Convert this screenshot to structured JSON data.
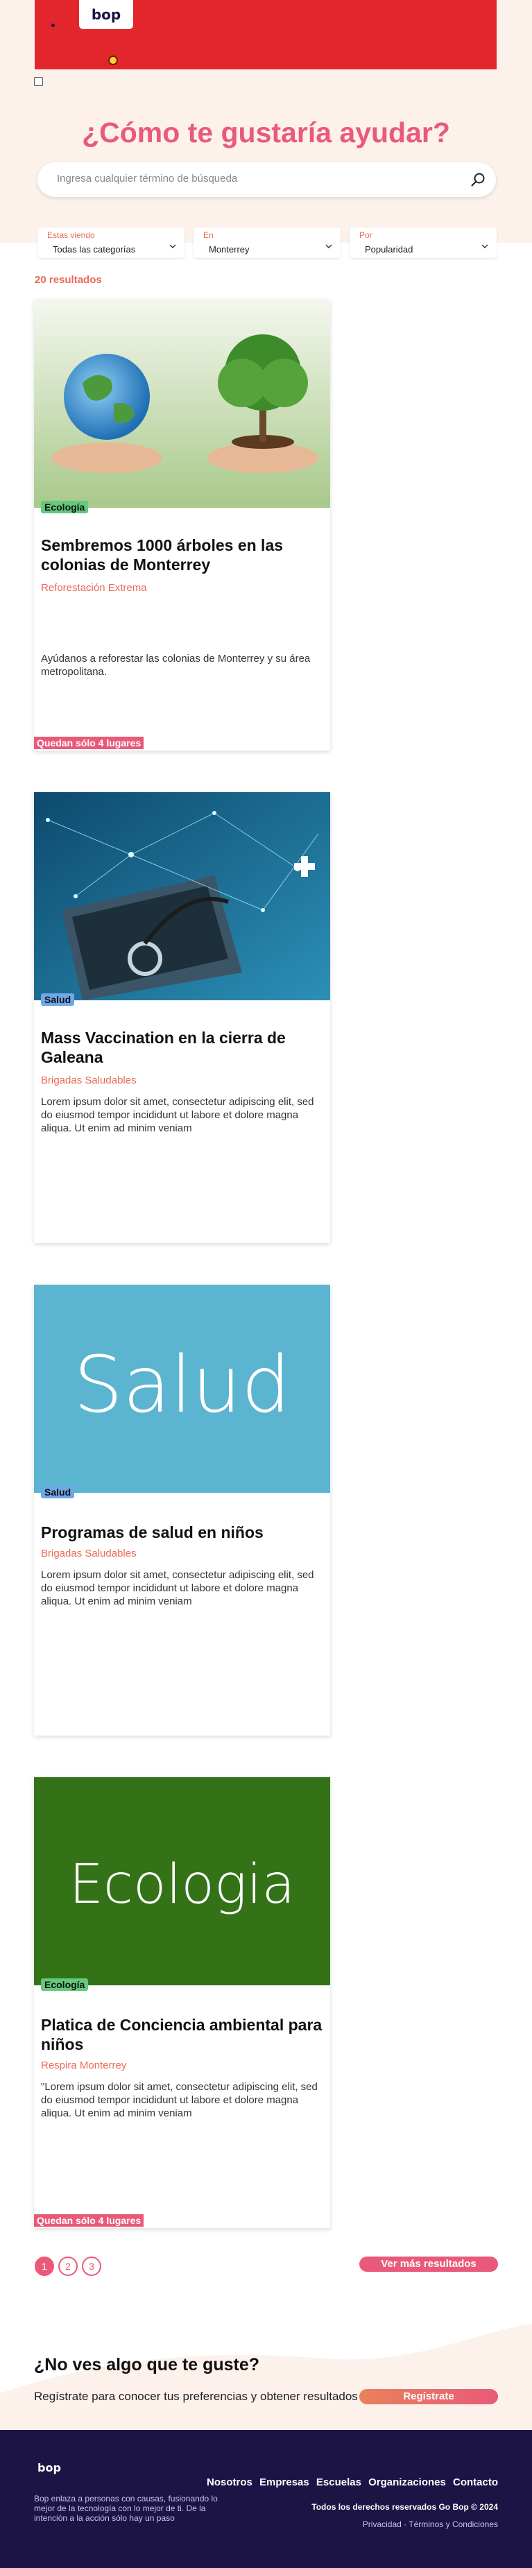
{
  "header": {
    "logo": "bop"
  },
  "hero": {
    "title": "¿Cómo te gustaría ayudar?",
    "search_placeholder": "Ingresa cualquier término de búsqueda"
  },
  "filters": [
    {
      "label": "Estas viendo",
      "value": "Todas las categorías"
    },
    {
      "label": "En",
      "value": "Monterrey"
    },
    {
      "label": "Por",
      "value": "Popularidad"
    }
  ],
  "results_count": "20 resultados",
  "cards": [
    {
      "image_label": "",
      "image_icon": "hands-earth-tree-image",
      "category": "Ecología",
      "title": "Sembremos 1000 árboles en las colonias de Monterrey",
      "organization": "Reforestación Extrema",
      "description": "Ayúdanos a reforestar las colonias de Monterrey y su área metropolitana.",
      "spots": "Quedan sólo 4 lugares"
    },
    {
      "image_label": "",
      "image_icon": "stethoscope-laptop-image",
      "category": "Salud",
      "title": "Mass Vaccination en la cierra de Galeana",
      "organization": "Brigadas Saludables",
      "description": "Lorem ipsum dolor sit amet, consectetur adipiscing elit, sed do eiusmod tempor incididunt ut labore et dolore magna aliqua. Ut enim ad minim veniam",
      "spots": ""
    },
    {
      "image_label": "Salud",
      "category": "Salud",
      "title": "Programas de salud en niños",
      "organization": "Brigadas Saludables",
      "description": "Lorem ipsum dolor sit amet, consectetur adipiscing elit, sed do eiusmod tempor incididunt ut labore et dolore magna aliqua. Ut enim ad minim veniam",
      "spots": ""
    },
    {
      "image_label": "Ecologia",
      "category": "Ecología",
      "title": "Platica de Conciencia ambiental para niños",
      "organization": "Respira Monterrey",
      "description": "\"Lorem ipsum dolor sit amet, consectetur adipiscing elit, sed do eiusmod tempor incididunt ut labore et dolore magna aliqua. Ut enim ad minim veniam",
      "spots": "Quedan sólo 4 lugares"
    }
  ],
  "pagination": {
    "pages": [
      "1",
      "2",
      "3"
    ],
    "active": "1",
    "more_label": "Ver más resultados"
  },
  "cta": {
    "title": "¿No ves algo que te guste?",
    "subtitle": "Regístrate para conocer tus preferencias y obtener resultados",
    "button": "Regístrate"
  },
  "footer": {
    "logo": "bop",
    "tagline": "Bop enlaza a personas con causas, fusionando lo mejor de la tecnología con lo mejor de ti. De la intención a la acción sólo hay un paso",
    "nav": [
      "Nosotros",
      "Empresas",
      "Escuelas",
      "Organizaciones",
      "Contacto"
    ],
    "copyright": "Todos los derechos reservados Go Bop © 2024",
    "links": "Privacidad · Términos y Condiciones"
  },
  "colors": {
    "brand_red": "#e3262c",
    "accent_pink": "#e95a7a",
    "accent_orange": "#e96a55",
    "footer_navy": "#1d1446",
    "hero_bg": "#fdf1ec",
    "salud_tile": "#5bb5d0",
    "ecologia_tile": "#347218"
  }
}
